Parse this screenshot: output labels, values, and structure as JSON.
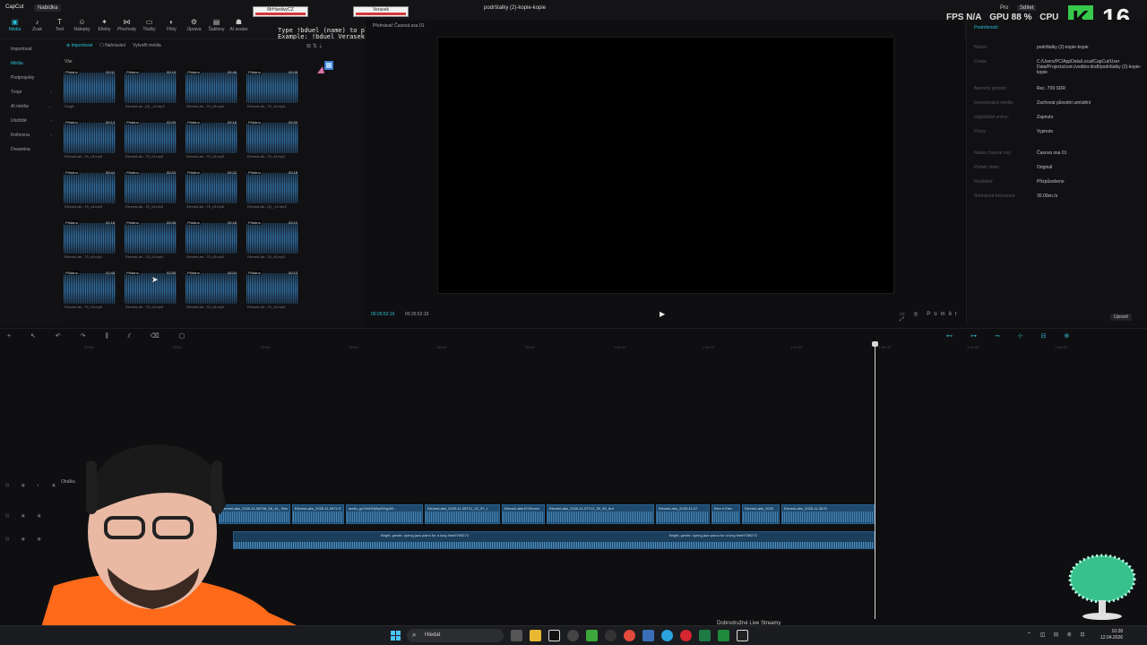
{
  "app": {
    "logo": "CapCut",
    "menu_button": "Nabídka",
    "project_title": "podrštalky (2)-kopie-kopie"
  },
  "toolbar": {
    "tools": [
      {
        "label": "Média",
        "icon": "media-icon",
        "glyph": "▣"
      },
      {
        "label": "Zvuk",
        "icon": "audio-icon",
        "glyph": "♪"
      },
      {
        "label": "Text",
        "icon": "text-icon",
        "glyph": "T"
      },
      {
        "label": "Nálepky",
        "icon": "sticker-icon",
        "glyph": "☺"
      },
      {
        "label": "Efekty",
        "icon": "effects-icon",
        "glyph": "✦"
      },
      {
        "label": "Přechody",
        "icon": "transitions-icon",
        "glyph": "⋈"
      },
      {
        "label": "Titulky",
        "icon": "captions-icon",
        "glyph": "▭"
      },
      {
        "label": "Filtry",
        "icon": "filters-icon",
        "glyph": "◐"
      },
      {
        "label": "Úprava",
        "icon": "adjust-icon",
        "glyph": "⚙"
      },
      {
        "label": "Šablony",
        "icon": "templates-icon",
        "glyph": "▤"
      },
      {
        "label": "AI avatar",
        "icon": "ai-avatar-icon",
        "glyph": "☗"
      }
    ]
  },
  "stream_overlay": {
    "box1": "MrHardwyCZ",
    "box2": "Verasek",
    "command_line1": "Type !bduel (name) to play",
    "command_line2": "Example: !bduel Verasek",
    "fps_label": "FPS N/A",
    "gpu_label": "GPU 88 %",
    "cpu_label": "CPU",
    "pro_label": "Pro",
    "share_label": "Sdílet",
    "k_badge": "K",
    "big_number": "16",
    "bottom_text": "Dobrodružné Live Streamy"
  },
  "left_nav": {
    "items": [
      {
        "label": "Importovat",
        "active": false
      },
      {
        "label": "Média",
        "active": true
      },
      {
        "label": "Podprojekty",
        "active": false
      },
      {
        "label": "Tvoje",
        "active": false,
        "arrow": "›"
      },
      {
        "label": "AI média",
        "active": false,
        "arrow": "→"
      },
      {
        "label": "Uložiště",
        "active": false,
        "arrow": "›"
      },
      {
        "label": "Knihovna",
        "active": false,
        "arrow": "›"
      },
      {
        "label": "Dreamina",
        "active": false
      }
    ]
  },
  "media_panel": {
    "tabs": [
      {
        "label": "⊕ Importovat",
        "active": true
      },
      {
        "label": "☐ Nahrávání",
        "active": false
      },
      {
        "label": "Vytvořit média",
        "active": false
      }
    ],
    "filter": "Vše",
    "sort_icons": "⊞  ⇅  ⇣",
    "clips": [
      {
        "tag": "Přidáno",
        "dur": "00:11",
        "name": "Smg8"
      },
      {
        "tag": "Přidáno",
        "dur": "00:18",
        "name": "ElevenLab...(3) _v3.mp3"
      },
      {
        "tag": "Přidáno",
        "dur": "00:46",
        "name": "ElevenLab...75_v3.mp3"
      },
      {
        "tag": "Přidáno",
        "dur": "00:08",
        "name": "ElevenLab...75_v3.mp3"
      },
      {
        "tag": "Přidáno",
        "dur": "00:13",
        "name": "ElevenLab...75_v3.mp3"
      },
      {
        "tag": "Přidáno",
        "dur": "02:09",
        "name": "ElevenLab...75_v3.mp3"
      },
      {
        "tag": "Přidáno",
        "dur": "00:16",
        "name": "ElevenLab...75_v3.mp3"
      },
      {
        "tag": "Přidáno",
        "dur": "00:30",
        "name": "ElevenLab...75_v3.mp3"
      },
      {
        "tag": "Přidáno",
        "dur": "05:44",
        "name": "ElevenLab...75_v3.mp3"
      },
      {
        "tag": "Přidáno",
        "dur": "00:34",
        "name": "ElevenLab...75_v3.mp3"
      },
      {
        "tag": "Přidáno",
        "dur": "00:22",
        "name": "ElevenLab...75_v3.mp3"
      },
      {
        "tag": "Přidáno",
        "dur": "00:18",
        "name": "ElevenLab...(2) _v3.mp3"
      },
      {
        "tag": "Přidáno",
        "dur": "02:18",
        "name": "ElevenLab...75_v3.mp3"
      },
      {
        "tag": "Přidáno",
        "dur": "00:08",
        "name": "ElevenLab...75_v3.mp3"
      },
      {
        "tag": "Přidáno",
        "dur": "00:18",
        "name": "ElevenLab...75_v3.mp3"
      },
      {
        "tag": "Přidáno",
        "dur": "00:10",
        "name": "ElevenLab...75_v3.mp3"
      },
      {
        "tag": "Přidáno",
        "dur": "01:48",
        "name": "ElevenLab...75_v3.mp3"
      },
      {
        "tag": "Přidáno",
        "dur": "02:55",
        "name": "ElevenLab...75_v3.mp3"
      },
      {
        "tag": "Přidáno",
        "dur": "00:04",
        "name": "ElevenLab...75_v3.mp3"
      },
      {
        "tag": "Přidáno",
        "dur": "00:10",
        "name": "ElevenLab...75_v3.mp3"
      }
    ]
  },
  "preview": {
    "title": "Přehrávač Časová osa 01",
    "timecode_current": "00:26:52:16",
    "timecode_total": "00:26:52:16",
    "play_glyph": "▶",
    "icons": "▭ ◎ Poměr ⤢"
  },
  "details": {
    "title": "Podrobnosti",
    "rows": [
      {
        "k": "Název:",
        "v": "podrštalky (2)-kopie-kopie"
      },
      {
        "k": "Cesta:",
        "v": "C:/Users/PC/AppData/Local/CapCut/User Data/Projects/com.lveditor.draft/podrštalky (2)-kopie-kopie"
      },
      {
        "k": "Barevný prostor:",
        "v": "Rec. 709 SDR"
      },
      {
        "k": "Importovaná média:",
        "v": "Zachovat původní umístění"
      },
      {
        "k": "Uspořádat vrstvy:",
        "v": "Zapnuto"
      },
      {
        "k": "Proxy:",
        "v": "Vypnuto"
      },
      {
        "k": "Název časové osy:",
        "v": "Časová osa 01"
      },
      {
        "k": "Poměr stran:",
        "v": "Originál"
      },
      {
        "k": "Rozlišení:",
        "v": "Přizpůsobeno"
      },
      {
        "k": "Snímková frekvence:",
        "v": "30.00sn./s"
      }
    ],
    "export_label": "Upravit"
  },
  "timeline": {
    "toolbar": "+ ↖ ↶ ↷ ⫼ ⫽ ⌫ ▢",
    "right_tools": "⊷ ⊶ ⊸ ⊹ ⊟ ⊕",
    "ticks": [
      "00:00",
      "10:00",
      "20:00",
      "30:00",
      "40:00",
      "50:00",
      "1:00:00",
      "1:10:00",
      "1:20:00",
      "1:30:00",
      "1:40:00",
      "1:50:00"
    ],
    "main_track_label": "Obálka",
    "audio_clips": [
      {
        "label": "ElevenLabs_2025-11-06T06_58_44_ ElevenLab"
      },
      {
        "label": "ElevenLabs_2025-11-06T1 El"
      },
      {
        "label": "audio_jyCHnDHjSqIGHgx53..."
      },
      {
        "label": "ElevenLabs_2025-11-06T12_32_57_t"
      },
      {
        "label": "ElevenLabs El Eleven"
      },
      {
        "label": "ElevenLabs_2025-11-07T12_35_53_Ant"
      },
      {
        "label": "ElevenLabs_2025-11-07"
      },
      {
        "label": "Elev e Elev"
      },
      {
        "label": "ElevenLabs_2025"
      },
      {
        "label": "ElevenLabs_2025-11-08 El"
      }
    ],
    "music_labels": [
      "Bright, gentle, spring jazz piano for a long time9789273",
      "Bright, gentle, spring jazz piano for a long time9789273"
    ]
  },
  "taskbar": {
    "search_placeholder": "Hledat",
    "clock_time": "10:28",
    "clock_date": "12.04.2026",
    "tray": "⌃ ◫ ⊟ ⊜ ⊡"
  }
}
